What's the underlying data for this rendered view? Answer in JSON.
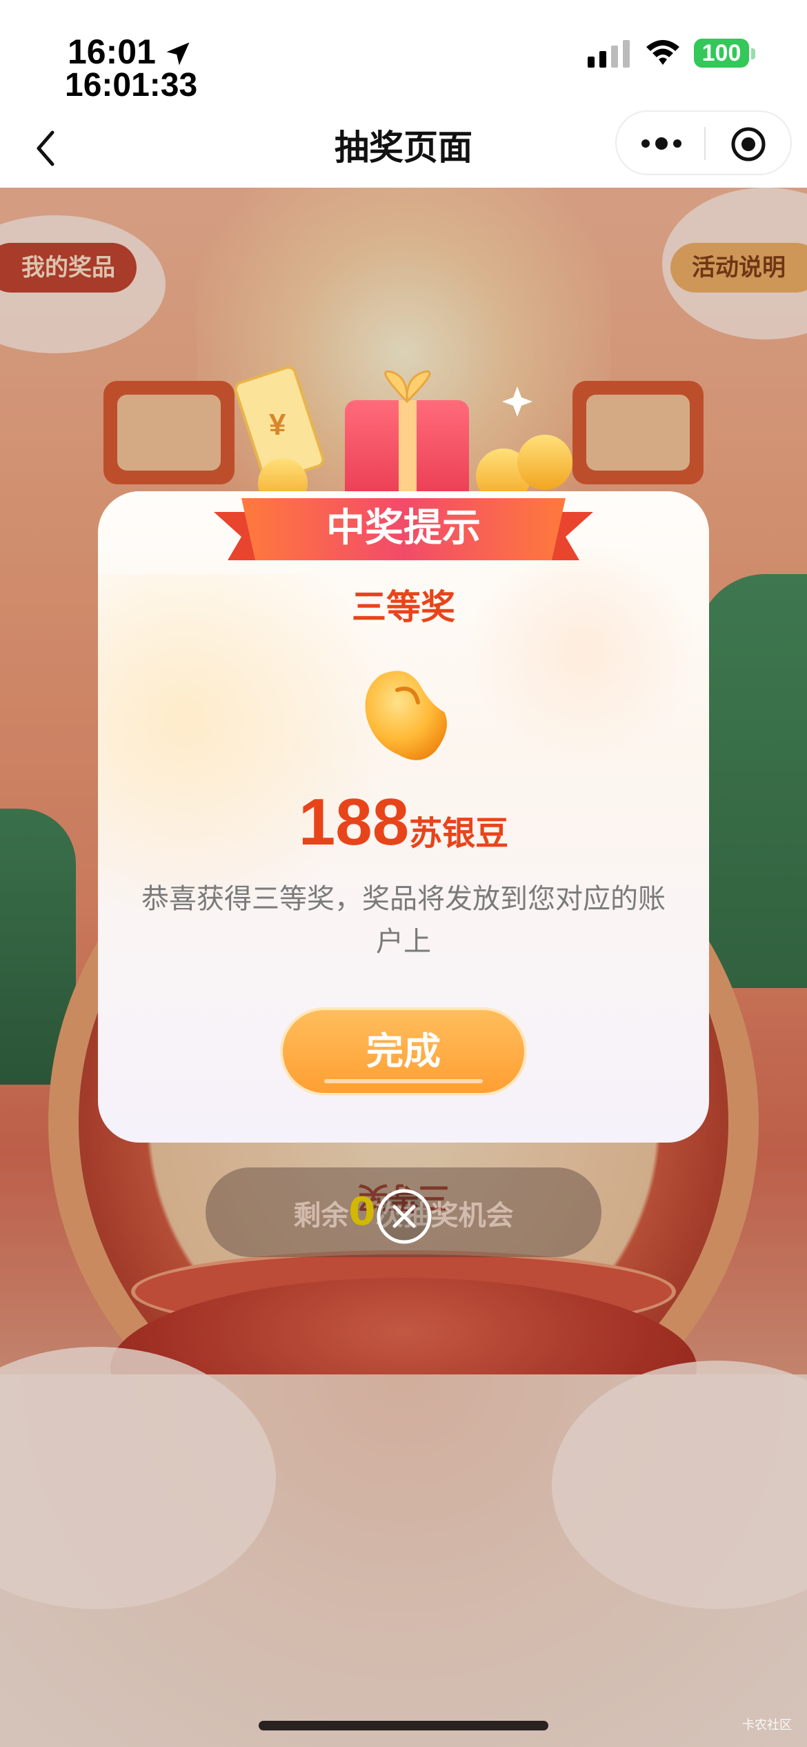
{
  "status_bar": {
    "time": "16:01",
    "time_seconds": "16:01:33",
    "battery": "100"
  },
  "nav": {
    "title": "抽奖页面"
  },
  "page": {
    "my_prizes": "我的奖品",
    "rules": "活动说明",
    "wheel_segment": "三等奖",
    "remaining_prefix": "剩余",
    "remaining_count": "0",
    "remaining_suffix": "次抽奖机会"
  },
  "modal": {
    "ribbon_title": "中奖提示",
    "prize_level": "三等奖",
    "amount": "188",
    "unit": "苏银豆",
    "description": "恭喜获得三等奖，奖品将发放到您对应的账户上",
    "done_label": "完成"
  },
  "watermark": "卡农社区",
  "colors": {
    "accent_red": "#e8441a",
    "button_orange": "#ff9f33",
    "ribbon_pink": "#f24b6a",
    "battery_green": "#34c759"
  }
}
